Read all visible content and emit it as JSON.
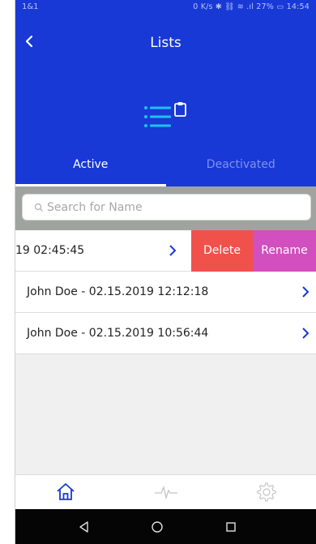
{
  "status_bar": {
    "carrier": "1&1",
    "right": "0 K/s ✱ ⛓ ≋ .ıl 27% ▭ 14:54"
  },
  "header": {
    "title": "Lists"
  },
  "tabs": [
    {
      "label": "Active",
      "selected": true
    },
    {
      "label": "Deactivated",
      "selected": false
    }
  ],
  "search": {
    "placeholder": "Search for Name"
  },
  "list": {
    "swiped_row": {
      "text": "19 02:45:45",
      "delete_label": "Delete",
      "rename_label": "Rename"
    },
    "rows": [
      {
        "text": "John Doe - 02.15.2019 12:12:18"
      },
      {
        "text": "John Doe - 02.15.2019 10:56:44"
      }
    ]
  },
  "colors": {
    "primary": "#1839d6",
    "accent": "#1ec3f0",
    "delete": "#f1514b",
    "rename": "#d14fbf"
  },
  "bottom_nav": [
    {
      "icon": "home-icon",
      "active": true
    },
    {
      "icon": "pulse-icon",
      "active": false
    },
    {
      "icon": "gear-icon",
      "active": false
    }
  ],
  "android_nav": [
    "back-triangle-icon",
    "home-circle-icon",
    "recents-square-icon"
  ]
}
